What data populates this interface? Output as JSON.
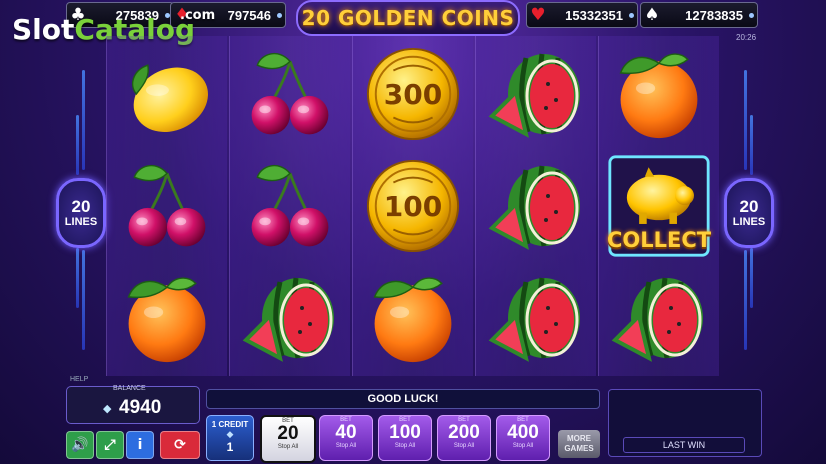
{
  "jackpots": [
    {
      "suit": "club",
      "symbol": "♣",
      "value": "275839",
      "color": "#ffffff"
    },
    {
      "suit": "diamond",
      "symbol": "♦",
      "value": "797546",
      "color": "#e81f2c"
    },
    {
      "suit": "heart",
      "symbol": "♥",
      "value": "15332351",
      "color": "#e81f2c"
    },
    {
      "suit": "spade",
      "symbol": "♠",
      "value": "12783835",
      "color": "#ffffff"
    }
  ],
  "title": "20 GOLDEN COINS",
  "clock": "20:26",
  "watermark": {
    "part1": "Slot",
    "part2": "Catalog",
    "suffix": ".com"
  },
  "reels": [
    [
      "lemon",
      "cherries",
      "orange"
    ],
    [
      "cherries",
      "cherries",
      "watermelon"
    ],
    [
      "coin-300",
      "coin-100",
      "orange"
    ],
    [
      "watermelon",
      "watermelon",
      "watermelon"
    ],
    [
      "orange",
      "piggy-collect",
      "watermelon"
    ]
  ],
  "coins": {
    "coin-300": "300",
    "coin-100": "100"
  },
  "collect_label": "COLLECT",
  "lines": {
    "value": "20",
    "label": "LINES"
  },
  "help_label": "HELP",
  "balance": {
    "label": "BALANCE",
    "value": "4940"
  },
  "status_message": "GOOD LUCK!",
  "credit": {
    "title": "1 CREDIT",
    "icon": "💎",
    "value": "1"
  },
  "bets": [
    {
      "header": "BET",
      "value": "20",
      "sub": "Stop All",
      "selected": true
    },
    {
      "header": "BET",
      "value": "40",
      "sub": "Stop All",
      "selected": false
    },
    {
      "header": "BET",
      "value": "100",
      "sub": "Stop All",
      "selected": false
    },
    {
      "header": "BET",
      "value": "200",
      "sub": "Stop All",
      "selected": false
    },
    {
      "header": "BET",
      "value": "400",
      "sub": "Stop All",
      "selected": false
    }
  ],
  "more_games": {
    "line1": "MORE",
    "line2": "GAMES"
  },
  "last_win_label": "LAST WIN",
  "controls": [
    {
      "name": "sound-icon",
      "glyph": "🔊",
      "color": "#2e9e4a"
    },
    {
      "name": "fullscreen-icon",
      "glyph": "⤢",
      "color": "#2e9e4a"
    },
    {
      "name": "info-icon",
      "glyph": "i",
      "color": "#2d6de0"
    },
    {
      "name": "autoplay-icon",
      "glyph": "⟳",
      "color": "#d92a3a"
    }
  ]
}
